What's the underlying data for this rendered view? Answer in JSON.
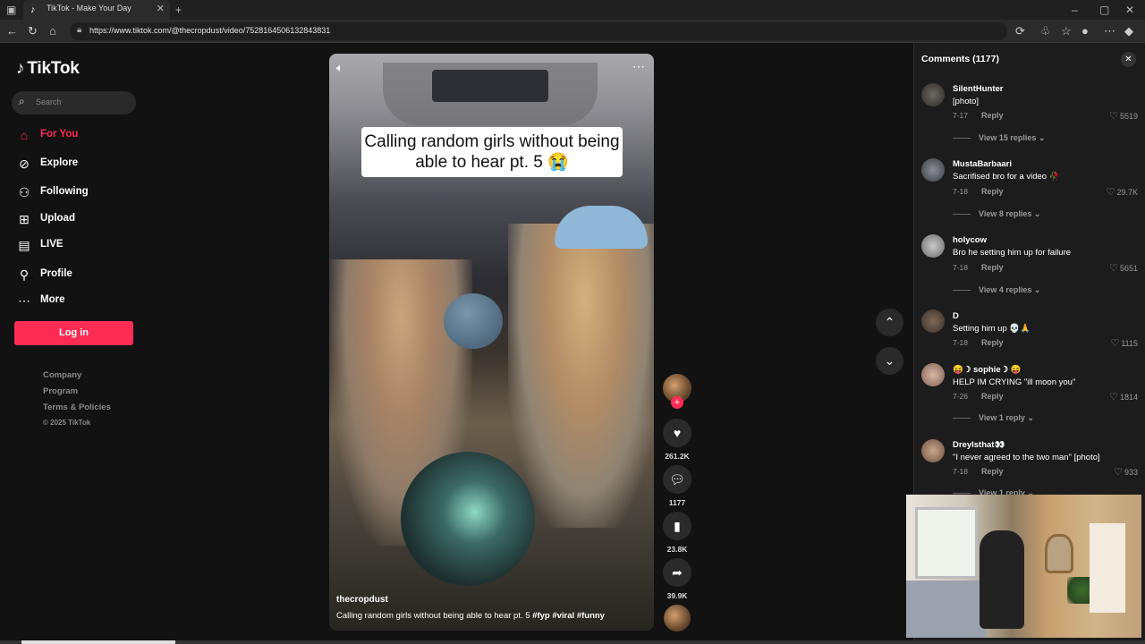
{
  "browser": {
    "tab_title": "TikTok - Make Your Day",
    "url": "https://www.tiktok.com/@thecropdust/video/7528164506132843831"
  },
  "sidebar": {
    "logo": "TikTok",
    "search_placeholder": "Search",
    "items": [
      {
        "label": "For You",
        "icon": "home-icon",
        "active": true
      },
      {
        "label": "Explore",
        "icon": "compass-icon"
      },
      {
        "label": "Following",
        "icon": "following-icon"
      },
      {
        "label": "Upload",
        "icon": "upload-icon"
      },
      {
        "label": "LIVE",
        "icon": "live-icon"
      },
      {
        "label": "Profile",
        "icon": "profile-icon"
      },
      {
        "label": "More",
        "icon": "more-icon"
      }
    ],
    "login_label": "Log in",
    "footer": {
      "links": [
        "Company",
        "Program",
        "Terms & Policies"
      ],
      "copyright": "© 2025 TikTok"
    }
  },
  "video": {
    "overlay_caption": "Calling random girls without being able to hear pt. 5 😭",
    "author": "thecropdust",
    "description": "Calling random girls without being able to hear pt. 5",
    "hashtags": [
      "#fyp",
      "#viral",
      "#funny"
    ]
  },
  "actions": {
    "likes": "261.2K",
    "comments": "1177",
    "saves": "23.8K",
    "shares": "39.9K"
  },
  "comments_panel": {
    "title": "Comments (1177)",
    "reply_label": "Reply",
    "comments": [
      {
        "user": "SilentHunter",
        "text": "[photo]",
        "date": "7-17",
        "likes": "5519",
        "view_replies": "View 15 replies"
      },
      {
        "user": "MustaBarbaari",
        "text": "Sacrifised bro for a video 🥀",
        "date": "7-18",
        "likes": "29.7K",
        "view_replies": "View 8 replies"
      },
      {
        "user": "holycow",
        "text": "Bro he setting him up for failure",
        "date": "7-18",
        "likes": "5651",
        "view_replies": "View 4 replies"
      },
      {
        "user": "D",
        "text": "Setting him up 💀🙏",
        "date": "7-18",
        "likes": "1115",
        "view_replies": ""
      },
      {
        "user": "😝☽ sophie☽ 😝",
        "text": "HELP IM CRYING \"ill moon you\"",
        "date": "7-26",
        "likes": "1814",
        "view_replies": "View 1 reply"
      },
      {
        "user": "DreyIsthat👀",
        "text": "\"I never agreed to the two man\" [photo]",
        "date": "7-18",
        "likes": "933",
        "view_replies": "View 1 reply"
      }
    ]
  },
  "colors": {
    "accent": "#fe2c55",
    "background": "#121212",
    "panel": "#1c1c1c"
  }
}
